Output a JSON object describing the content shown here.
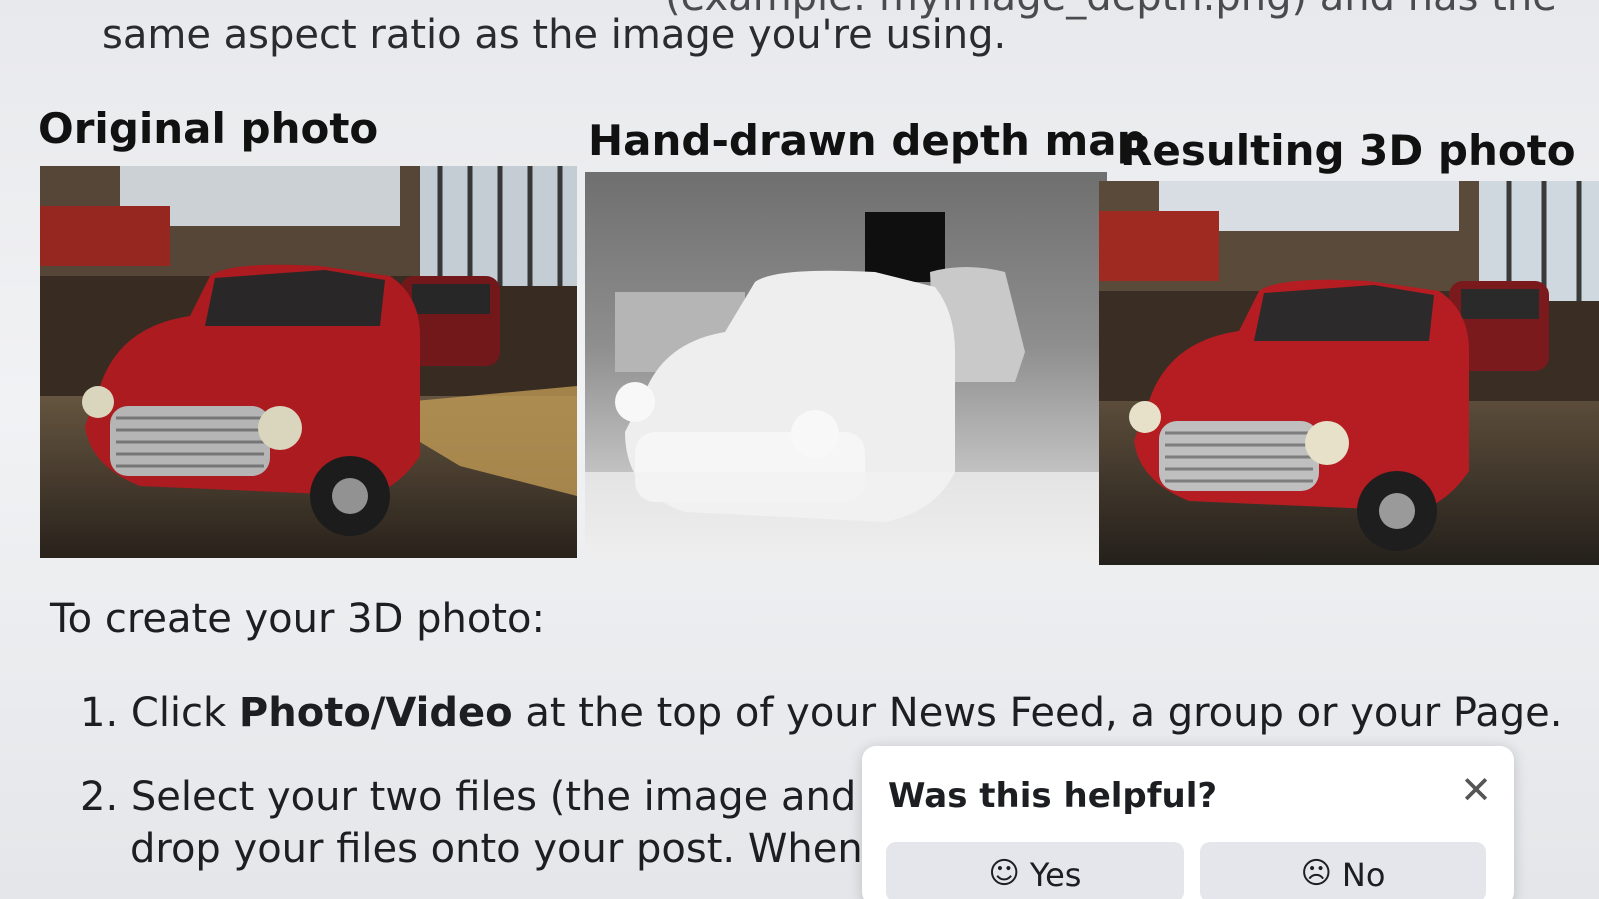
{
  "intro": {
    "line_top": "(example: myimage_depth.png) and has the",
    "line_main": "same aspect ratio as the image you're using."
  },
  "photos": [
    {
      "heading": "Original photo"
    },
    {
      "heading": "Hand-drawn depth map"
    },
    {
      "heading": "Resulting 3D photo"
    }
  ],
  "instructions": {
    "title": "To create your 3D photo:",
    "step1": {
      "number": "1.",
      "before": "Click",
      "bold": "Photo/Video",
      "after": "at the top of your News Feed, a group or your Page."
    },
    "step2": {
      "number": "2.",
      "line1": "Select your two files (the image and t",
      "line2": "drop your files onto your post. When"
    }
  },
  "feedback": {
    "title": "Was this helpful?",
    "close_icon": "close-icon",
    "yes_label": "Yes",
    "no_label": "No",
    "yes_icon": "smile-icon",
    "no_icon": "frown-icon"
  },
  "colors": {
    "car_red": "#b51d22",
    "page_bg": "#eceef1",
    "popup_bg": "#ffffff",
    "button_bg": "#e4e6eb"
  }
}
